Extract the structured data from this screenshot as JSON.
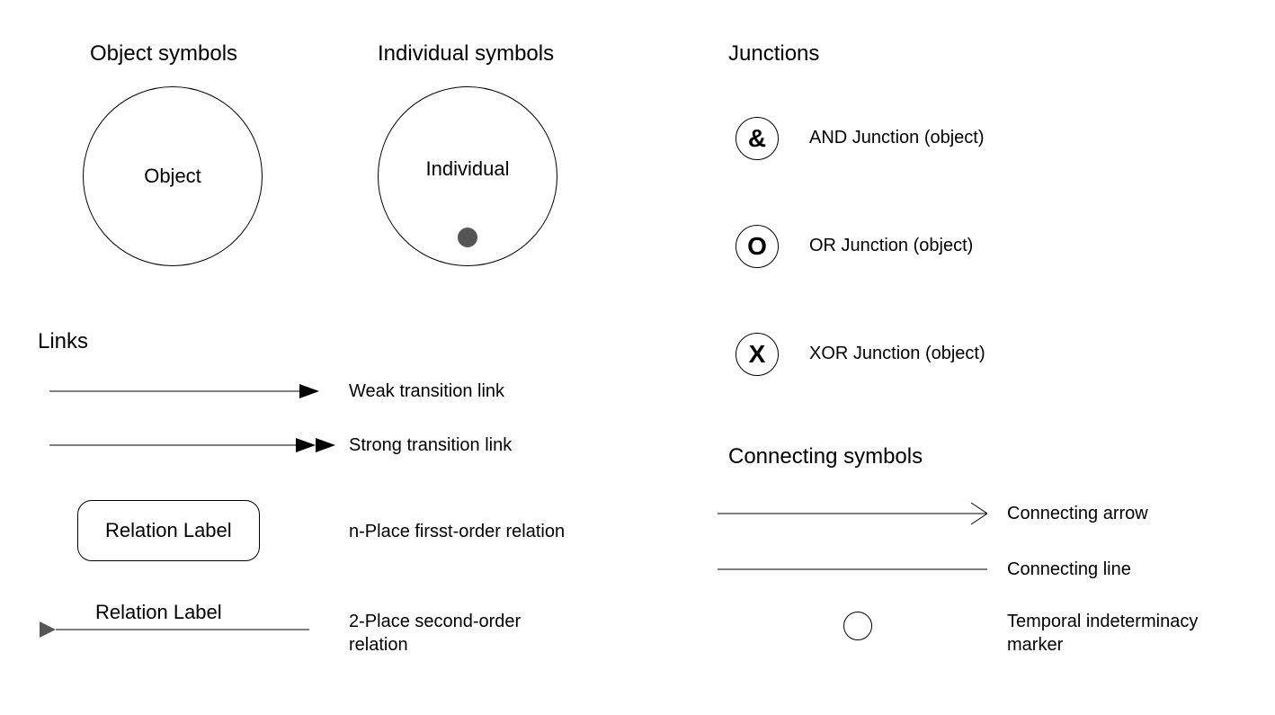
{
  "headings": {
    "object_symbols": "Object symbols",
    "individual_symbols": "Individual symbols",
    "junctions": "Junctions",
    "links": "Links",
    "connecting_symbols": "Connecting symbols"
  },
  "symbols": {
    "object_label": "Object",
    "individual_label": "Individual"
  },
  "junctions": {
    "and": {
      "glyph": "&",
      "label": "AND Junction (object)"
    },
    "or": {
      "glyph": "O",
      "label": "OR Junction (object)"
    },
    "xor": {
      "glyph": "X",
      "label": "XOR Junction (object)"
    }
  },
  "links": {
    "weak": "Weak transition link",
    "strong": "Strong transition link",
    "n_place": "n-Place firsst-order relation",
    "relation_label": "Relation Label",
    "two_place_top": "2-Place second-order",
    "two_place_bottom": "relation",
    "relation_label_2": "Relation Label"
  },
  "connecting": {
    "arrow": "Connecting arrow",
    "line": "Connecting line",
    "temporal_top": "Temporal indeterminacy",
    "temporal_bottom": "marker"
  }
}
